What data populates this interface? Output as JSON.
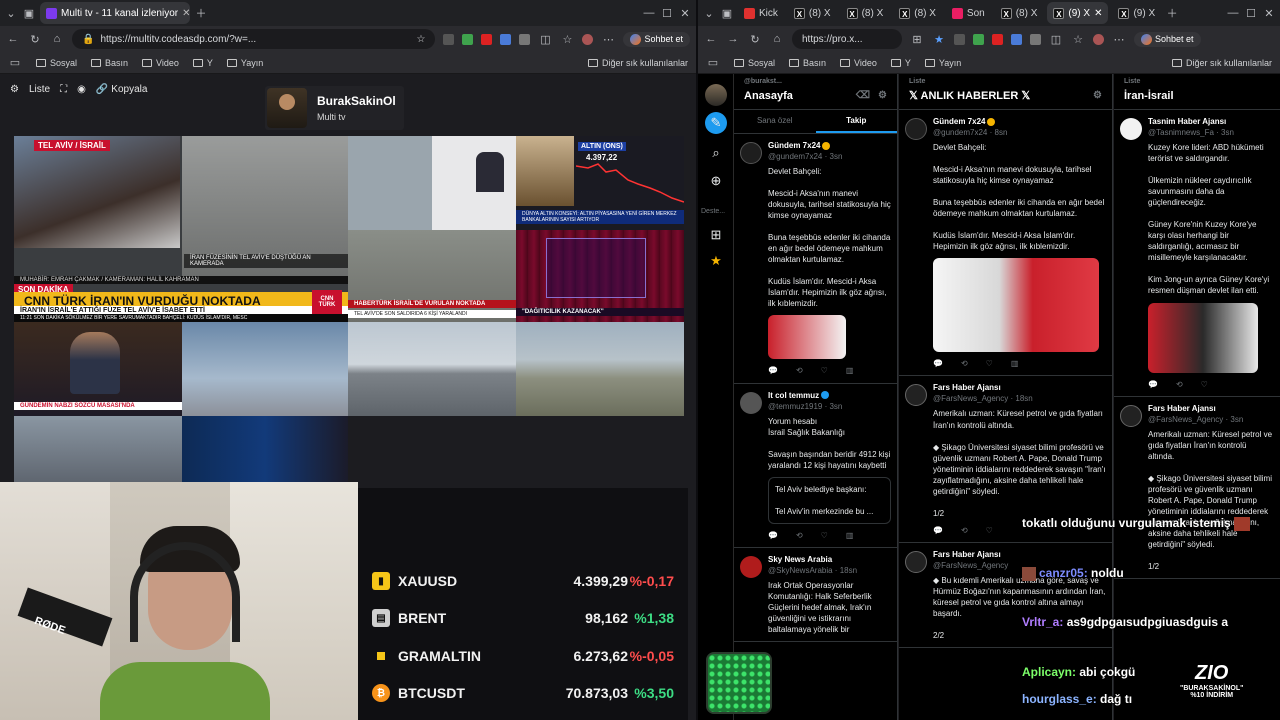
{
  "left_window": {
    "tabs": [
      {
        "label": "Multi tv - 11 kanal izleniyor",
        "active": true
      }
    ],
    "url": "https://multitv.codeasdp.com/?w=...",
    "chat_label": "Sohbet et",
    "bookmarks": [
      "Sosyal",
      "Basın",
      "Video",
      "Y",
      "Yayın"
    ],
    "bookmarks_other": "Diğer sık kullanılanlar"
  },
  "multitv": {
    "toolbar": {
      "list": "Liste",
      "copy": "Kopyala"
    },
    "channel": {
      "name": "BurakSakinOl",
      "subtitle": "Multi tv"
    },
    "tiles": {
      "t1_tag": "TEL AVİV / İSRAİL",
      "t1_caption": "İRAN FÜZESİNİN TEL AVİV'E DÜŞTÜĞÜ AN KAMERADA",
      "t1_crew": "MUHABİR: EMRAH ÇAKMAK / KAMERAMAN: HALİL KAHRAMAN",
      "t1_banner_tag": "SON DAKİKA",
      "t1_banner": "CNN TÜRK İRAN'IN VURDUĞU NOKTADA",
      "t1_sub": "İRAN'IN İSRAİL'E ATTIĞI FÜZE TEL AVİV'E İSABET ETTİ",
      "t1_logo": "CNN TÜRK",
      "t1_ticker": "11:21  SON DAKİKA  SÖKÜLMEZ BİR YERE SAVRUMAKTADIR  BAHÇELİ: KUDÜS İSLAM'DIR, MESC",
      "t3_title": "ALTIN (ONS)",
      "t3_price": "4.397,22",
      "t3_banner": "DÜNYA ALTIN KONSEYİ: ALTIN PİYASASINA YENİ GİREN MERKEZ BANKALARININ SAYISI ARTIYOR",
      "t4_caption": "HABERTÜRK İSRAİL'DE VURULAN NOKTADA",
      "t4_sub": "TEL AVİV'DE SON SALDIRIDA 6 KİŞİ YARALANDI",
      "t5_caption": "\"DAĞITICILIK KAZANACAK\"",
      "t6_caption": "GÜNDEMİN NABZI SÖZCÜ MASASI'NDA"
    },
    "market": [
      {
        "symbol": "XAUUSD",
        "value": "4.399,29",
        "change": "%-0,17",
        "icon": "gold-bar-icon",
        "icon_color": "#f5c518",
        "change_color": "#ff4d4d"
      },
      {
        "symbol": "BRENT",
        "value": "98,162",
        "change": "%1,38",
        "icon": "oil-barrel-icon",
        "icon_color": "#cfcfcf",
        "change_color": "#3ddc84"
      },
      {
        "symbol": "GRAMALTIN",
        "value": "6.273,62",
        "change": "%-0,05",
        "icon": "gold-square-icon",
        "icon_color": "#f5c518",
        "change_color": "#ff4d4d"
      },
      {
        "symbol": "BTCUSDT",
        "value": "70.873,03",
        "change": "%3,50",
        "icon": "bitcoin-icon",
        "icon_color": "#f7931a",
        "change_color": "#3ddc84"
      }
    ],
    "cam_label": "RØDE"
  },
  "right_window": {
    "tabs": [
      {
        "label": "Kick"
      },
      {
        "label": "(8) X"
      },
      {
        "label": "(8) X"
      },
      {
        "label": "(8) X"
      },
      {
        "label": "Son"
      },
      {
        "label": "(8) X"
      },
      {
        "label": "(9) X",
        "active": true
      },
      {
        "label": "(9) X"
      }
    ],
    "url": "https://pro.x...",
    "chat_label": "Sohbet et",
    "bookmarks": [
      "Sosyal",
      "Basın",
      "Video",
      "Y",
      "Yayın"
    ],
    "bookmarks_other": "Diğer sık kullanılanlar"
  },
  "xpro": {
    "nav_label": "Deste...",
    "columns": [
      {
        "sub": "@burakst...",
        "title": "Anasayfa",
        "tabs": [
          "Sana özel",
          "Takip"
        ]
      },
      {
        "sub": "Liste",
        "title": "𝕏 ANLIK HABERLER 𝕏"
      },
      {
        "sub": "Liste",
        "title": "İran-İsrail"
      }
    ],
    "col1_tweets": [
      {
        "name": "Gündem 7x24",
        "handle": "@gundem7x24 · 3sn",
        "body": "Devlet Bahçeli:\n\nMescid-i Aksa'nın manevi dokusuyla, tarihsel statikosuyla hiç kimse oynayamaz\n\nBuna teşebbüs edenler iki cihanda en ağır bedel ödemeye mahkum olmaktan kurtulamaz.\n\nKudüs İslam'dır. Mescid-i Aksa İslam'dır. Hepimizin ilk göz ağrısı, ilk kıblemizdir."
      },
      {
        "name": "It col temmuz",
        "handle": "@temmuz1919 · 3sn",
        "body": "Yorum hesabı\nİsrail Sağlık Bakanlığı\n\nSavaşın başından beridir 4912 kişi yaralandı 12 kişi hayatını kaybetti",
        "quote": "Tel Aviv belediye başkanı:\n\nTel Aviv'in merkezinde bu ..."
      },
      {
        "name": "Sky News Arabia",
        "handle": "@SkyNewsArabia · 18sn",
        "body": "Irak Ortak Operasyonlar Komutanlığı: Halk Seferberlik Güçlerini hedef almak, Irak'ın güvenliğini ve istikrarını baltalamaya yönelik bir"
      }
    ],
    "col2_tweets": [
      {
        "name": "Gündem 7x24",
        "handle": "@gundem7x24 · 8sn",
        "body": "Devlet Bahçeli:\n\nMescid-i Aksa'nın manevi dokusuyla, tarihsel statikosuyla hiç kimse oynayamaz\n\nBuna teşebbüs edenler iki cihanda en ağır bedel ödemeye mahkum olmaktan kurtulamaz.\n\nKudüs İslam'dır. Mescid-i Aksa İslam'dır. Hepimizin ilk göz ağrısı, ilk kıblemizdir."
      },
      {
        "name": "Fars Haber Ajansı",
        "handle": "@FarsNews_Agency · 18sn",
        "body": "Amerikalı uzman: Küresel petrol ve gıda fiyatları İran'ın kontrolü altında.\n\n◆ Şikago Üniversitesi siyaset bilimi profesörü ve güvenlik uzmanı Robert A. Pape, Donald Trump yönetiminin iddialarını reddederek savaşın \"İran'ı zayıflatmadığını, aksine daha tehlikeli hale getirdiğini\" söyledi.\n\n1/2"
      },
      {
        "name": "Fars Haber Ajansı",
        "handle": "@FarsNews_Agency",
        "body": "◆ Bu kıdemli Amerikalı uzmana göre, savaş ve Hürmüz Boğazı'nın kapanmasının ardından İran, küresel petrol ve gıda kontrol altına almayı başardı.\n\n2/2"
      }
    ],
    "col3_tweets": [
      {
        "name": "Tasnim Haber Ajansı",
        "handle": "@Tasnimnews_Fa · 3sn",
        "body": "Kuzey Kore lideri: ABD hükümeti terörist ve saldırgandır.\n\n Ülkemizin nükleer caydırıcılık savunmasını daha da güçlendireceğiz.\n\nGüney Kore'nin Kuzey Kore'ye karşı olası herhangi bir saldırganlığı, acımasız bir misillemeyle karşılanacaktır.\n\nKim Jong-un ayrıca Güney Kore'yi resmen düşman devlet ilan etti."
      },
      {
        "name": "Fars Haber Ajansı",
        "handle": "@FarsNews_Agency · 3sn",
        "body": "Amerikalı uzman: Küresel petrol ve gıda fiyatları İran'ın kontrolü altında.\n\n◆ Şikago Üniversitesi siyaset bilimi profesörü ve güvenlik uzmanı Robert A. Pape, Donald Trump yönetiminin iddialarını reddederek savaşın \"İran'ı zayıflatmadığını, aksine daha tehlikeli hale getirdiğini\" söyledi.\n\n1/2"
      }
    ]
  },
  "stream_chat": [
    {
      "user": "",
      "text": "tokatlı olduğunu vurgulamak istemiş",
      "user_color": "#ffffff"
    },
    {
      "user": "canzr05:",
      "text": "noldu",
      "user_color": "#7d8cff"
    },
    {
      "user": "Vrltr_a:",
      "text": "as9gdpgaısudpgiuasdguis a",
      "user_color": "#b07dff"
    },
    {
      "user": "Aplicayn:",
      "text": "abi çokgü",
      "user_color": "#7dff6a"
    },
    {
      "user": "hourglass_e:",
      "text": "dağ tı",
      "user_color": "#8cb4ff"
    }
  ],
  "overlay": {
    "logo": "ZIO",
    "line1": "\"BURAKSAKİNOL\"",
    "line2": "%10 İNDİRİM"
  }
}
